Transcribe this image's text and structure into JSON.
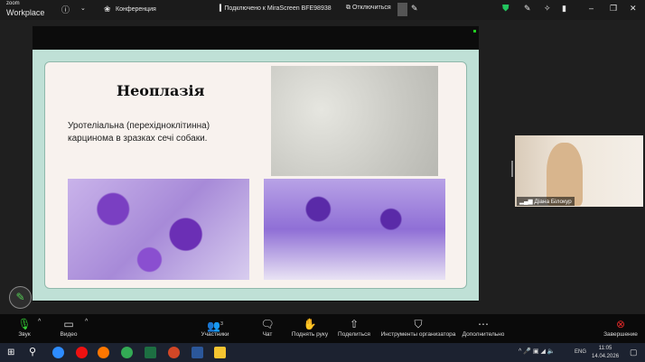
{
  "app": {
    "logo_top": "zoom",
    "logo_bottom": "Workplace",
    "meeting_label": "Конференция",
    "connection": "Подключено к MiraScreen BFE98938",
    "disconnect": "Отключиться"
  },
  "slide": {
    "title": "Неоплазія",
    "text_line1": "Уротеліальна (перехідноклітинна)",
    "text_line2": "карцинома в зразках сечі собаки."
  },
  "participant": {
    "name": "Діана Білокур"
  },
  "toolbar": {
    "audio": "Звук",
    "video": "Видео",
    "participants": "Участники",
    "participants_count": "3",
    "chat": "Чат",
    "raise_hand": "Поднять руку",
    "share": "Поделиться",
    "host_tools": "Инструменты организатора",
    "more": "Дополнительно",
    "end": "Завершение"
  },
  "taskbar": {
    "lang": "ENG",
    "time": "11:05",
    "date": "14.04.2026"
  },
  "colors": {
    "slide_border": "#bfe0d6",
    "slide_bg": "#f8f2ee",
    "end": "#e02828",
    "shield": "#22c55e"
  }
}
